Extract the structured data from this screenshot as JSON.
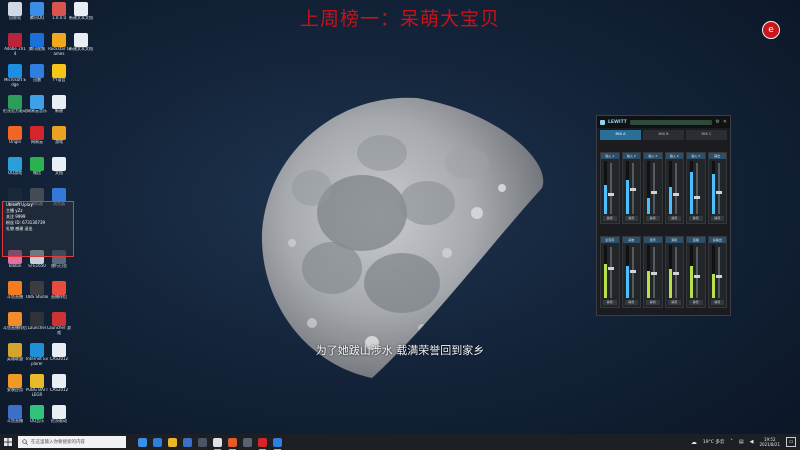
{
  "headline": "上周榜一：呆萌大宝贝",
  "subtitle": "为了她跋山涉水 载满荣誉回到家乡",
  "corner_logo_glyph": "e",
  "desktop_icons": [
    {
      "label": "回收站",
      "color": "#cfd8e3",
      "col": 0,
      "row": 0
    },
    {
      "label": "腾讯QQ",
      "color": "#3a8ee6",
      "col": 1,
      "row": 0
    },
    {
      "label": "1.0.0.0",
      "color": "#d9534f",
      "col": 2,
      "row": 0
    },
    {
      "label": "新建文本文档",
      "color": "#e8eef4",
      "col": 3,
      "row": 0
    },
    {
      "label": "Adobe 2014",
      "color": "#b9243b",
      "col": 0,
      "row": 1
    },
    {
      "label": "腾讯视频",
      "color": "#1a6fd8",
      "col": 1,
      "row": 1
    },
    {
      "label": "Rockstar Games",
      "color": "#f0a81d",
      "col": 2,
      "row": 1
    },
    {
      "label": "新建文本文档",
      "color": "#e8eef4",
      "col": 3,
      "row": 1
    },
    {
      "label": "Microsoft Edge",
      "color": "#1d8fe0",
      "col": 0,
      "row": 2
    },
    {
      "label": "迅雷",
      "color": "#2f7fe0",
      "col": 1,
      "row": 2
    },
    {
      "label": "YY语音",
      "color": "#f5c518",
      "col": 2,
      "row": 2
    },
    {
      "label": "伦茨官方驱动",
      "color": "#2d9e5a",
      "col": 0,
      "row": 3
    },
    {
      "label": "网易云音乐",
      "color": "#3ea0e8",
      "col": 1,
      "row": 3
    },
    {
      "label": "新建",
      "color": "#e8eef4",
      "col": 2,
      "row": 3
    },
    {
      "label": "Origin",
      "color": "#f26522",
      "col": 0,
      "row": 4
    },
    {
      "label": "网易云",
      "color": "#d6252a",
      "col": 1,
      "row": 4
    },
    {
      "label": "游戏",
      "color": "#e9a321",
      "col": 2,
      "row": 4
    },
    {
      "label": "QQ游戏",
      "color": "#2b9ed8",
      "col": 0,
      "row": 5
    },
    {
      "label": "微信",
      "color": "#2bb24c",
      "col": 1,
      "row": 5
    },
    {
      "label": "文档",
      "color": "#e8eef4",
      "col": 2,
      "row": 5
    },
    {
      "label": "Steam",
      "color": "#1b2838",
      "col": 0,
      "row": 6
    },
    {
      "label": "模拟器",
      "color": "#444b55",
      "col": 1,
      "row": 6
    },
    {
      "label": "浏览器",
      "color": "#3479d8",
      "col": 2,
      "row": 6
    },
    {
      "label": "Bilibili",
      "color": "#e56fa0",
      "col": 0,
      "row": 8
    },
    {
      "label": "STE1650",
      "color": "#c7ced6",
      "col": 1,
      "row": 8
    },
    {
      "label": "旅行日志",
      "color": "#5a6a7d",
      "col": 2,
      "row": 8
    },
    {
      "label": "斗鱼直播",
      "color": "#f57c1f",
      "col": 0,
      "row": 9
    },
    {
      "label": "OBS Studio",
      "color": "#3a3d42",
      "col": 1,
      "row": 9
    },
    {
      "label": "直播伴侣",
      "color": "#e74c3c",
      "col": 2,
      "row": 9
    },
    {
      "label": "斗鱼直播伴侣",
      "color": "#f28b2c",
      "col": 0,
      "row": 10
    },
    {
      "label": "Launcher",
      "color": "#2f3338",
      "col": 1,
      "row": 10
    },
    {
      "label": "Launcher 游戏",
      "color": "#c33",
      "col": 2,
      "row": 10
    },
    {
      "label": "英雄联盟",
      "color": "#d4a52c",
      "col": 0,
      "row": 11
    },
    {
      "label": "Internet Explorer",
      "color": "#1e90d8",
      "col": 1,
      "row": 11
    },
    {
      "label": "CAS2012",
      "color": "#e8eef4",
      "col": 2,
      "row": 11
    },
    {
      "label": "安装应用",
      "color": "#f09a23",
      "col": 0,
      "row": 12
    },
    {
      "label": "PUBG BATTLEGR",
      "color": "#e9b92c",
      "col": 1,
      "row": 12
    },
    {
      "label": "CAS2012",
      "color": "#e8eef4",
      "col": 2,
      "row": 12
    },
    {
      "label": "斗鱼直播",
      "color": "#3c6fc6",
      "col": 0,
      "row": 13
    },
    {
      "label": "QQ音乐",
      "color": "#31c27c",
      "col": 1,
      "row": 13
    },
    {
      "label": "伦茨驱动",
      "color": "#e8eef4",
      "col": 2,
      "row": 13
    }
  ],
  "overlay": {
    "rows": [
      "Ubisoft   Uplay",
      "主播 yZz",
      "关注 9999",
      "粉丝 ID: 673130739",
      "礼物 感谢 送出"
    ]
  },
  "mixer": {
    "brand": "LEWITT",
    "tabs": [
      "MIX A",
      "MIX B",
      "MIX C"
    ],
    "active_tab": 0,
    "top_strips": [
      {
        "name": "输入 1",
        "level": 0.55,
        "fader": 0.35,
        "color": "#4cc0ff"
      },
      {
        "name": "输入 2",
        "level": 0.65,
        "fader": 0.45,
        "color": "#4cc0ff"
      },
      {
        "name": "输入 3",
        "level": 0.3,
        "fader": 0.4,
        "color": "#4cc0ff"
      },
      {
        "name": "输入 4",
        "level": 0.5,
        "fader": 0.35,
        "color": "#4cc0ff"
      },
      {
        "name": "输入 5",
        "level": 0.8,
        "fader": 0.3,
        "color": "#4cc0ff"
      },
      {
        "name": "输出",
        "level": 0.75,
        "fader": 0.4,
        "color": "#4cc0ff"
      }
    ],
    "bottom_strips": [
      {
        "name": "麦克风",
        "level": 0.65,
        "fader": 0.55,
        "color": "#b8e04a"
      },
      {
        "name": "系统",
        "level": 0.6,
        "fader": 0.5,
        "color": "#4cc0ff"
      },
      {
        "name": "音乐",
        "level": 0.5,
        "fader": 0.45,
        "color": "#b8e04a"
      },
      {
        "name": "耳机",
        "level": 0.55,
        "fader": 0.45,
        "color": "#b8e04a"
      },
      {
        "name": "直播",
        "level": 0.6,
        "fader": 0.4,
        "color": "#b8e04a"
      },
      {
        "name": "总输出",
        "level": 0.45,
        "fader": 0.4,
        "color": "#b8e04a"
      }
    ],
    "strip_button": "静音"
  },
  "taskbar": {
    "search_placeholder": "在这里输入你要搜索的内容",
    "apps": [
      {
        "color": "#3a8ee6",
        "active": false
      },
      {
        "color": "#2d7fd8",
        "active": false
      },
      {
        "color": "#e8b72c",
        "active": false
      },
      {
        "color": "#3c6fc6",
        "active": false
      },
      {
        "color": "#4b5563",
        "active": false
      },
      {
        "color": "#e0e3e6",
        "active": true
      },
      {
        "color": "#e45a2a",
        "active": true
      },
      {
        "color": "#5a6270",
        "active": false
      },
      {
        "color": "#d6252a",
        "active": true
      },
      {
        "color": "#2f7fe0",
        "active": true
      }
    ],
    "weather": "19°C  多云",
    "time": "19:52",
    "date": "2021/8/21"
  }
}
